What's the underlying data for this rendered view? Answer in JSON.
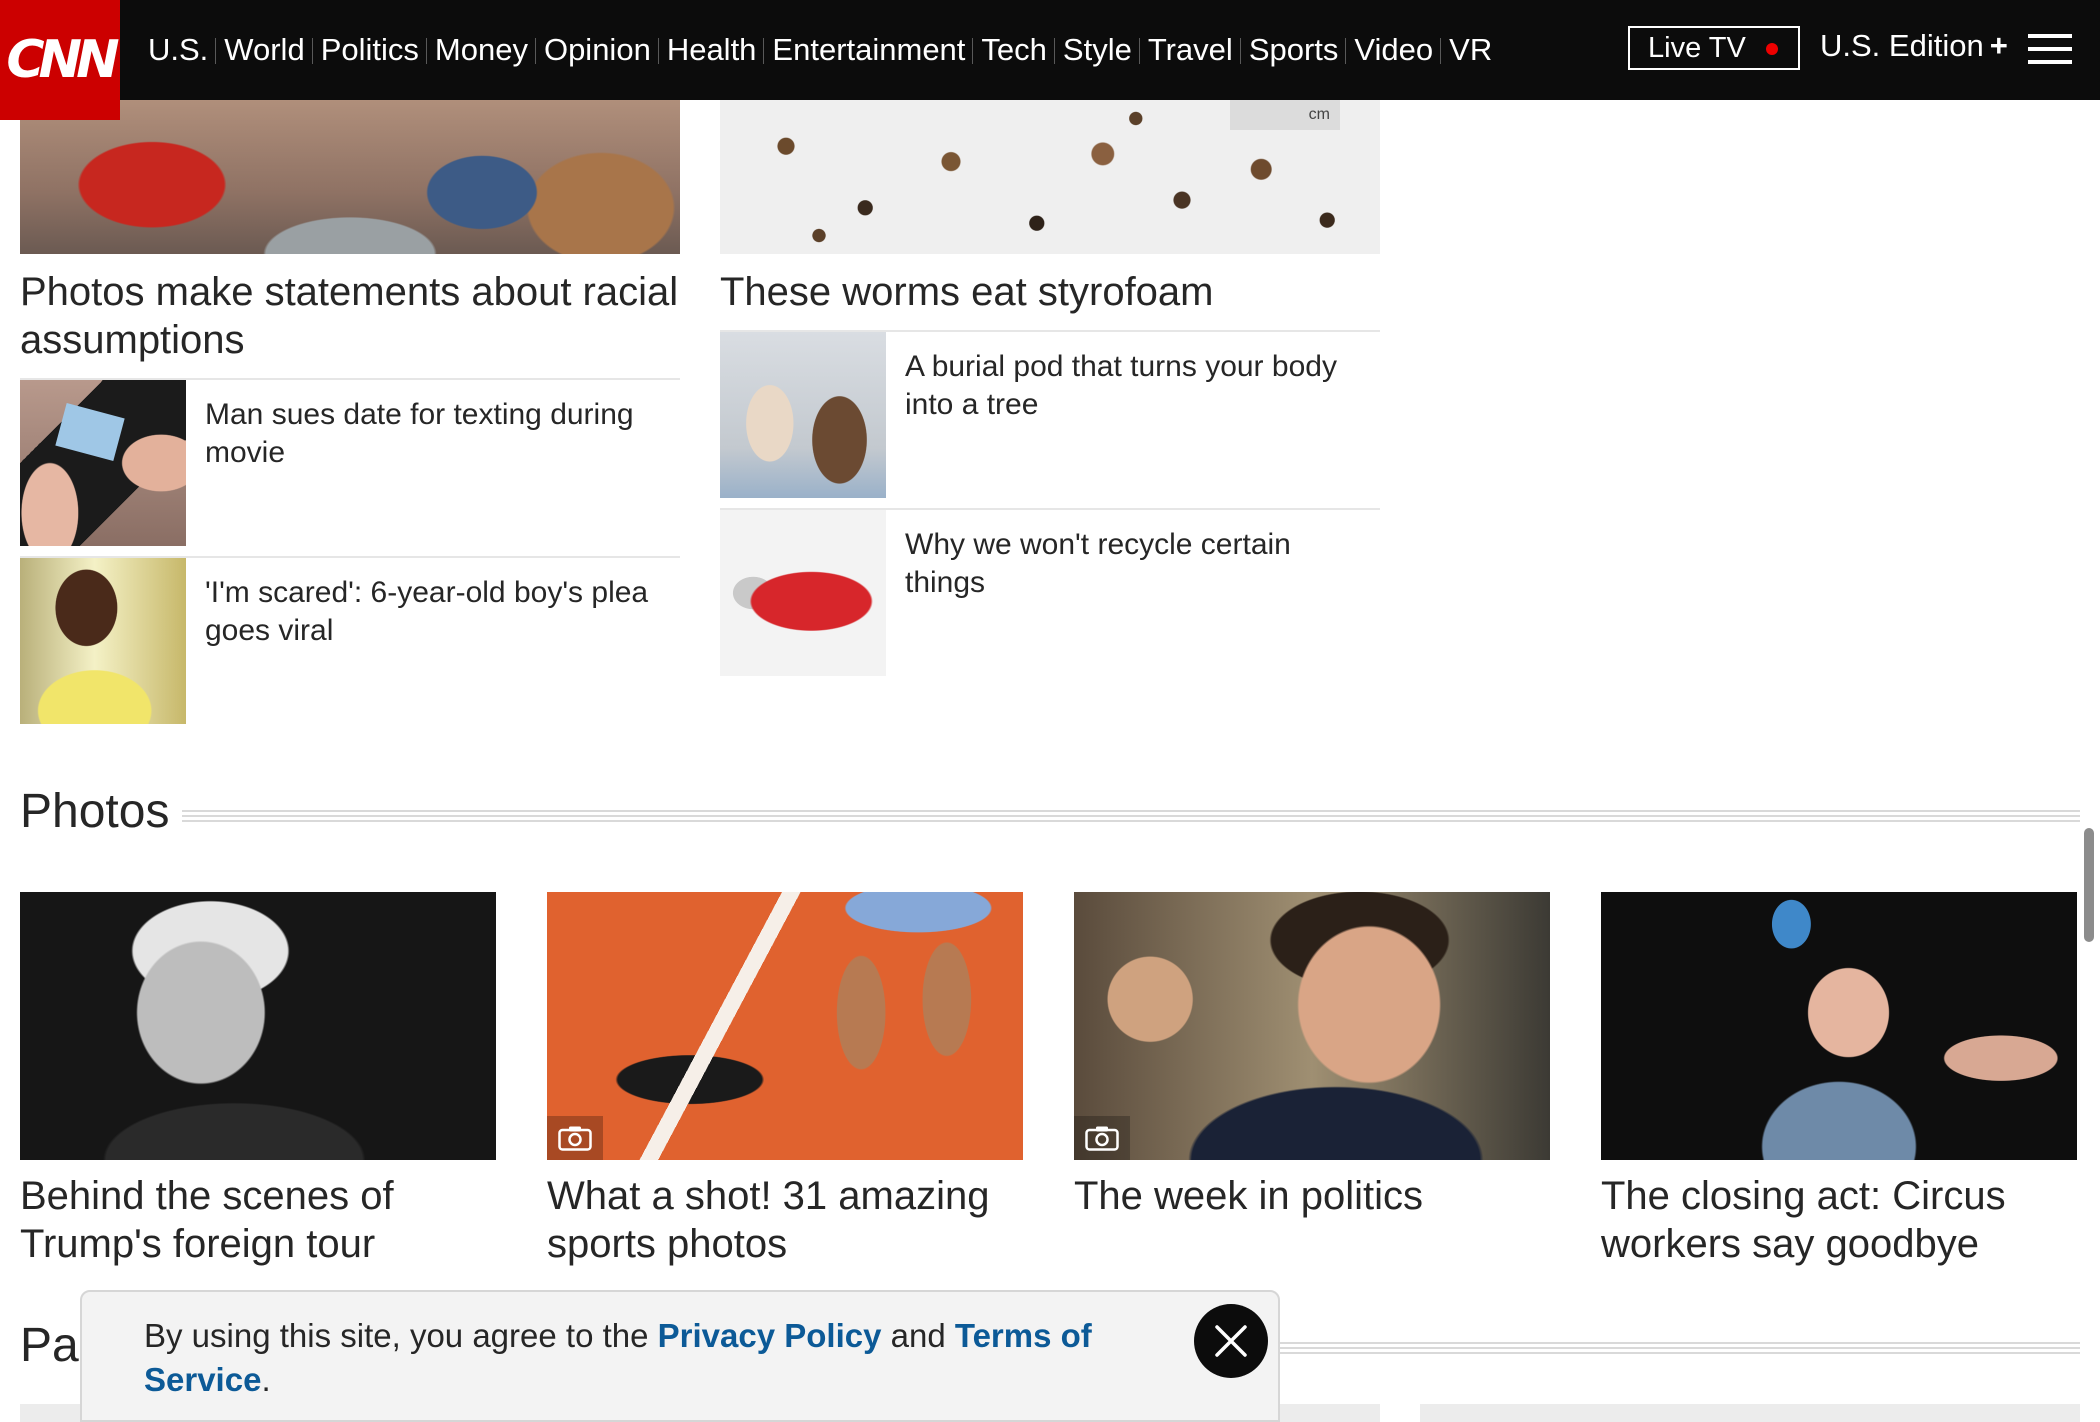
{
  "nav": {
    "logo": "CNN",
    "links": [
      "U.S.",
      "World",
      "Politics",
      "Money",
      "Opinion",
      "Health",
      "Entertainment",
      "Tech",
      "Style",
      "Travel",
      "Sports",
      "Video",
      "VR"
    ],
    "live_tv": "Live TV",
    "edition": "U.S. Edition",
    "edition_plus": "+"
  },
  "left_column": {
    "hero_title": "Photos make statements about racial assumptions",
    "items": [
      {
        "title": "Man sues date for texting during movie"
      },
      {
        "title": "'I'm scared': 6-year-old boy's plea goes viral"
      }
    ]
  },
  "right_column": {
    "hero_title": "These worms eat styrofoam",
    "ruler_label": "cm",
    "items": [
      {
        "title": "A burial pod that turns your body into a tree"
      },
      {
        "title": "Why we won't recycle certain things"
      }
    ]
  },
  "photos": {
    "heading": "Photos",
    "cards": [
      {
        "caption": "Behind the scenes of Trump's foreign tour",
        "gallery": false
      },
      {
        "caption": "What a shot! 31 amazing sports photos",
        "gallery": true
      },
      {
        "caption": "The week in politics",
        "gallery": true
      },
      {
        "caption": "The closing act: Circus workers say goodbye",
        "gallery": false
      }
    ]
  },
  "lower_section": {
    "heading_partial": "Pai"
  },
  "banner": {
    "text_before": "By using this site, you agree to the ",
    "privacy_link": "Privacy Policy",
    "text_middle": " and ",
    "terms_link": "Terms of Service",
    "text_after": "."
  },
  "colors": {
    "brand_red": "#cc0000",
    "nav_bg": "#0c0c0c",
    "link_blue": "#0c5a97",
    "live_dot": "#ee0000"
  }
}
